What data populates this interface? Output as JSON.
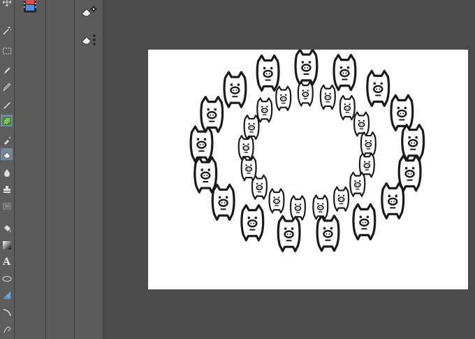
{
  "toolbar": {
    "items": [
      {
        "name": "move-tool",
        "icon": "move-icon"
      },
      {
        "name": "wand-tool",
        "icon": "wand-icon"
      },
      {
        "name": "marquee-tool",
        "icon": "marquee-icon"
      },
      {
        "name": "pen-tool",
        "icon": "pen-icon"
      },
      {
        "name": "pencil-tool",
        "icon": "pencil-icon"
      },
      {
        "name": "brush-tool",
        "icon": "brush-icon"
      },
      {
        "name": "pattern-tool",
        "icon": "pattern-icon"
      },
      {
        "name": "airbrush-tool",
        "icon": "airbrush-icon"
      },
      {
        "name": "eraser-tool",
        "icon": "eraser-icon"
      },
      {
        "name": "drop-tool",
        "icon": "droplet-icon"
      },
      {
        "name": "stamp-tool",
        "icon": "stamp-icon"
      },
      {
        "name": "frame-tool",
        "icon": "frame-icon"
      },
      {
        "name": "fill-tool",
        "icon": "bucket-icon"
      },
      {
        "name": "gradient-tool",
        "icon": "gradient-icon"
      },
      {
        "name": "text-tool",
        "icon": "text-icon",
        "label": "A"
      },
      {
        "name": "ellipse-tool",
        "icon": "ellipse-icon"
      },
      {
        "name": "ruler-tool",
        "icon": "ruler-icon"
      },
      {
        "name": "curve-tool",
        "icon": "curve-icon"
      },
      {
        "name": "lasso-tool",
        "icon": "lasso-icon"
      }
    ]
  },
  "subpanel": {
    "items": [
      {
        "name": "eraser-settings",
        "icon": "eraser-gear-icon"
      },
      {
        "name": "eraser-options",
        "icon": "eraser-dots-icon"
      }
    ]
  },
  "panel_a": {
    "icon": "film-layer-icon"
  },
  "colors": {
    "ui_dark": "#4b4b4b",
    "panel": "#5b5b5b",
    "active_tool": "#75879a",
    "canvas": "#ffffff",
    "ink": "#1a1a1a"
  },
  "canvas": {
    "content": "pig-stamp-pattern",
    "rings": [
      {
        "name": "outer-ring",
        "count": 17
      },
      {
        "name": "inner-ring",
        "count": 17
      }
    ]
  }
}
